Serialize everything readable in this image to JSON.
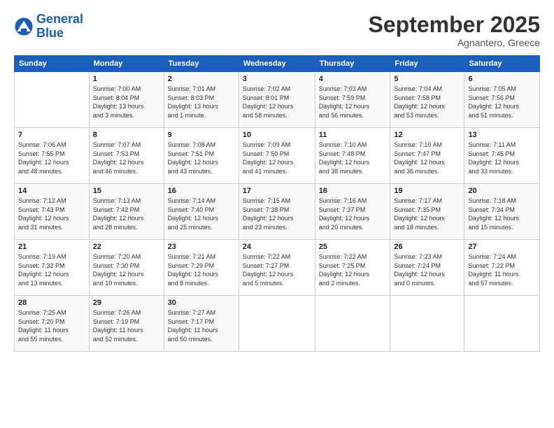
{
  "header": {
    "logo_line1": "General",
    "logo_line2": "Blue",
    "month": "September 2025",
    "location": "Agnantero, Greece"
  },
  "weekdays": [
    "Sunday",
    "Monday",
    "Tuesday",
    "Wednesday",
    "Thursday",
    "Friday",
    "Saturday"
  ],
  "weeks": [
    [
      {
        "day": "",
        "info": ""
      },
      {
        "day": "1",
        "info": "Sunrise: 7:00 AM\nSunset: 8:04 PM\nDaylight: 13 hours\nand 3 minutes."
      },
      {
        "day": "2",
        "info": "Sunrise: 7:01 AM\nSunset: 8:03 PM\nDaylight: 13 hours\nand 1 minute."
      },
      {
        "day": "3",
        "info": "Sunrise: 7:02 AM\nSunset: 8:01 PM\nDaylight: 12 hours\nand 58 minutes."
      },
      {
        "day": "4",
        "info": "Sunrise: 7:03 AM\nSunset: 7:59 PM\nDaylight: 12 hours\nand 56 minutes."
      },
      {
        "day": "5",
        "info": "Sunrise: 7:04 AM\nSunset: 7:58 PM\nDaylight: 12 hours\nand 53 minutes."
      },
      {
        "day": "6",
        "info": "Sunrise: 7:05 AM\nSunset: 7:56 PM\nDaylight: 12 hours\nand 51 minutes."
      }
    ],
    [
      {
        "day": "7",
        "info": "Sunrise: 7:06 AM\nSunset: 7:55 PM\nDaylight: 12 hours\nand 48 minutes."
      },
      {
        "day": "8",
        "info": "Sunrise: 7:07 AM\nSunset: 7:53 PM\nDaylight: 12 hours\nand 46 minutes."
      },
      {
        "day": "9",
        "info": "Sunrise: 7:08 AM\nSunset: 7:51 PM\nDaylight: 12 hours\nand 43 minutes."
      },
      {
        "day": "10",
        "info": "Sunrise: 7:09 AM\nSunset: 7:50 PM\nDaylight: 12 hours\nand 41 minutes."
      },
      {
        "day": "11",
        "info": "Sunrise: 7:10 AM\nSunset: 7:48 PM\nDaylight: 12 hours\nand 38 minutes."
      },
      {
        "day": "12",
        "info": "Sunrise: 7:10 AM\nSunset: 7:47 PM\nDaylight: 12 hours\nand 36 minutes."
      },
      {
        "day": "13",
        "info": "Sunrise: 7:11 AM\nSunset: 7:45 PM\nDaylight: 12 hours\nand 33 minutes."
      }
    ],
    [
      {
        "day": "14",
        "info": "Sunrise: 7:12 AM\nSunset: 7:43 PM\nDaylight: 12 hours\nand 31 minutes."
      },
      {
        "day": "15",
        "info": "Sunrise: 7:13 AM\nSunset: 7:42 PM\nDaylight: 12 hours\nand 28 minutes."
      },
      {
        "day": "16",
        "info": "Sunrise: 7:14 AM\nSunset: 7:40 PM\nDaylight: 12 hours\nand 25 minutes."
      },
      {
        "day": "17",
        "info": "Sunrise: 7:15 AM\nSunset: 7:38 PM\nDaylight: 12 hours\nand 23 minutes."
      },
      {
        "day": "18",
        "info": "Sunrise: 7:16 AM\nSunset: 7:37 PM\nDaylight: 12 hours\nand 20 minutes."
      },
      {
        "day": "19",
        "info": "Sunrise: 7:17 AM\nSunset: 7:35 PM\nDaylight: 12 hours\nand 18 minutes."
      },
      {
        "day": "20",
        "info": "Sunrise: 7:18 AM\nSunset: 7:34 PM\nDaylight: 12 hours\nand 15 minutes."
      }
    ],
    [
      {
        "day": "21",
        "info": "Sunrise: 7:19 AM\nSunset: 7:32 PM\nDaylight: 12 hours\nand 13 minutes."
      },
      {
        "day": "22",
        "info": "Sunrise: 7:20 AM\nSunset: 7:30 PM\nDaylight: 12 hours\nand 10 minutes."
      },
      {
        "day": "23",
        "info": "Sunrise: 7:21 AM\nSunset: 7:29 PM\nDaylight: 12 hours\nand 8 minutes."
      },
      {
        "day": "24",
        "info": "Sunrise: 7:22 AM\nSunset: 7:27 PM\nDaylight: 12 hours\nand 5 minutes."
      },
      {
        "day": "25",
        "info": "Sunrise: 7:22 AM\nSunset: 7:25 PM\nDaylight: 12 hours\nand 2 minutes."
      },
      {
        "day": "26",
        "info": "Sunrise: 7:23 AM\nSunset: 7:24 PM\nDaylight: 12 hours\nand 0 minutes."
      },
      {
        "day": "27",
        "info": "Sunrise: 7:24 AM\nSunset: 7:22 PM\nDaylight: 11 hours\nand 57 minutes."
      }
    ],
    [
      {
        "day": "28",
        "info": "Sunrise: 7:25 AM\nSunset: 7:20 PM\nDaylight: 11 hours\nand 55 minutes."
      },
      {
        "day": "29",
        "info": "Sunrise: 7:26 AM\nSunset: 7:19 PM\nDaylight: 11 hours\nand 52 minutes."
      },
      {
        "day": "30",
        "info": "Sunrise: 7:27 AM\nSunset: 7:17 PM\nDaylight: 11 hours\nand 50 minutes."
      },
      {
        "day": "",
        "info": ""
      },
      {
        "day": "",
        "info": ""
      },
      {
        "day": "",
        "info": ""
      },
      {
        "day": "",
        "info": ""
      }
    ]
  ]
}
